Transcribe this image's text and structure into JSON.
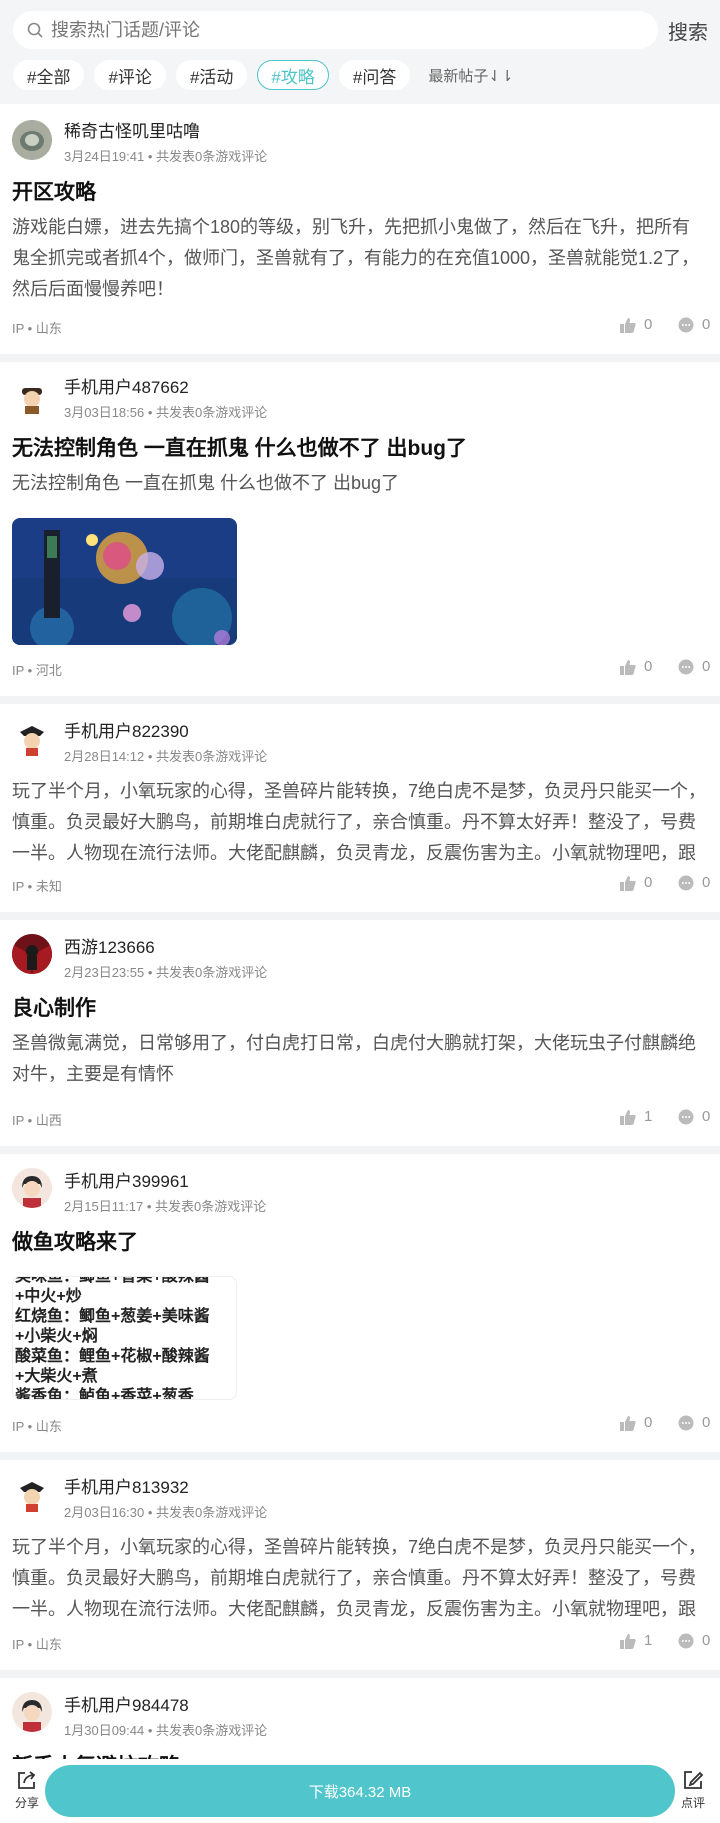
{
  "search": {
    "placeholder": "搜索热门话题/评论",
    "button": "搜索"
  },
  "filters": {
    "chips": [
      "#全部",
      "#评论",
      "#活动",
      "#攻略",
      "#问答"
    ],
    "active_index": 3,
    "sort": "最新帖子⇃⇂"
  },
  "posts": [
    {
      "user": "稀奇古怪叽里咕噜",
      "meta": "3月24日19:41 • 共发表0条游戏评论",
      "title": "开区攻略",
      "body": "游戏能白嫖，进去先搞个180的等级，别飞升，先把抓小鬼做了，然后在飞升，把所有鬼全抓完或者抓4个，做师门，圣兽就有了，有能力的在充值1000，圣兽就能觉1.2了，然后后面慢慢养吧！",
      "ip": "IP • 山东",
      "likes": "0",
      "comments": "0"
    },
    {
      "user": "手机用户487662",
      "meta": "3月03日18:56 • 共发表0条游戏评论",
      "title": "无法控制角色 一直在抓鬼 什么也做不了 出bug了",
      "body": "无法控制角色 一直在抓鬼 什么也做不了 出bug了",
      "ip": "IP • 河北",
      "likes": "0",
      "comments": "0"
    },
    {
      "user": "手机用户822390",
      "meta": "2月28日14:12 • 共发表0条游戏评论",
      "title": "",
      "body": "玩了半个月，小氧玩家的心得，圣兽碎片能转换，7绝白虎不是梦，负灵丹只能买一个，慎重。负灵最好大鹏鸟，前期堆白虎就行了，亲合慎重。丹不算太好弄！整没了，号费一半。人物现在流行法师。大佬配麒麟，负灵青龙，反震伤害为主。小氧就物理吧，跟白...",
      "ip": "IP • 未知",
      "likes": "0",
      "comments": "0"
    },
    {
      "user": "西游123666",
      "meta": "2月23日23:55 • 共发表0条游戏评论",
      "title": "良心制作",
      "body": "圣兽微氪满觉，日常够用了，付白虎打日常，白虎付大鹏就打架，大佬玩虫子付麒麟绝对牛，主要是有情怀",
      "ip": "IP • 山西",
      "likes": "1",
      "comments": "0"
    },
    {
      "user": "手机用户399961",
      "meta": "2月15日11:17 • 共发表0条游戏评论",
      "title": "做鱼攻略来了",
      "body": "",
      "recipe": [
        "美味鱼：鲫鱼+香菜+酸辣酱",
        "+中火+炒",
        "红烧鱼：鲫鱼+葱姜+美味酱",
        "+小柴火+焖",
        "酸菜鱼：鲤鱼+花椒+酸辣酱",
        "+大柴火+煮",
        " 酱香鱼：鲈鱼+香菜+葱香"
      ],
      "ip": "IP • 山东",
      "likes": "0",
      "comments": "0"
    },
    {
      "user": "手机用户813932",
      "meta": "2月03日16:30 • 共发表0条游戏评论",
      "title": "",
      "body": "玩了半个月，小氧玩家的心得，圣兽碎片能转换，7绝白虎不是梦，负灵丹只能买一个，慎重。负灵最好大鹏鸟，前期堆白虎就行了，亲合慎重。丹不算太好弄！整没了，号费一半。人物现在流行法师。大佬配麒麟，负灵青龙，反震伤害为主。小氧就物理吧，跟白...",
      "ip": "IP • 山东",
      "likes": "1",
      "comments": "0"
    },
    {
      "user": "手机用户984478",
      "meta": "1月30日09:44 • 共发表0条游戏评论",
      "title": "新手小氪避坑攻略",
      "body": "",
      "ip": "",
      "likes": "",
      "comments": ""
    }
  ],
  "bottom": {
    "share": "分享",
    "download": "下载364.32 MB",
    "review": "点评"
  },
  "colors": {
    "accent": "#50c6cc",
    "chip_active": "#4ec3c8",
    "page_bg": "#f2f3f5"
  }
}
